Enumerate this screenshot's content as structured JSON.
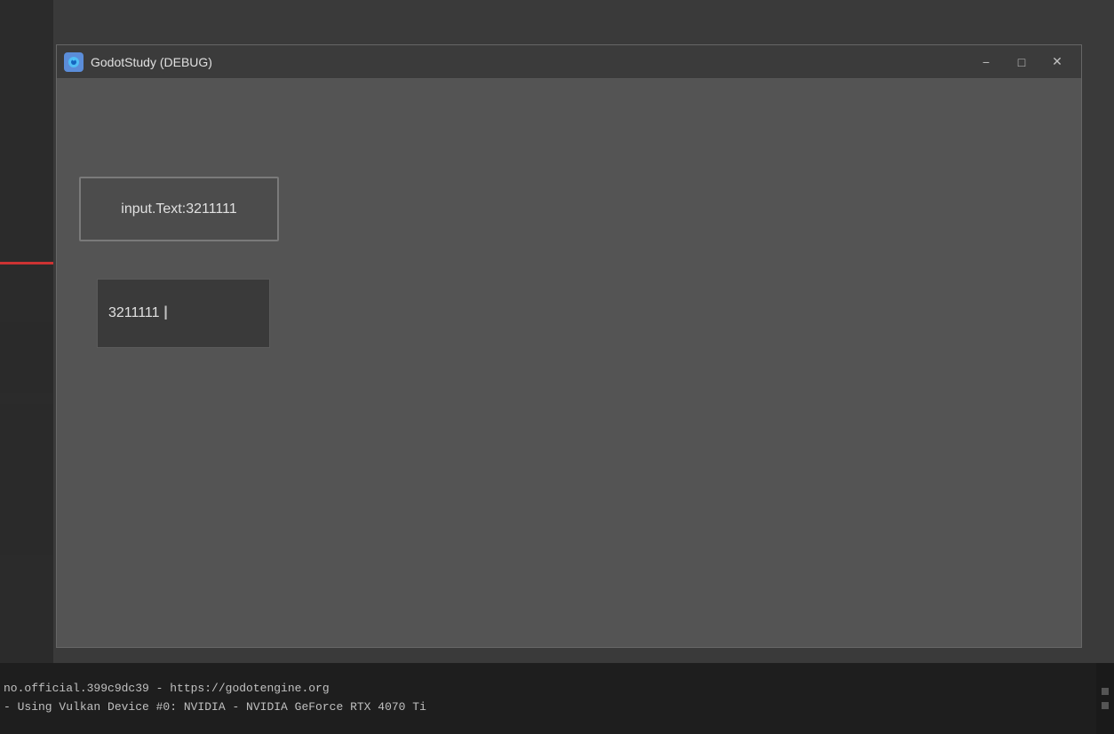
{
  "desktop": {
    "background_color": "#3a3a3a"
  },
  "window": {
    "title": "GodotStudy (DEBUG)",
    "icon_label": "godot-icon",
    "minimize_label": "−",
    "maximize_label": "□",
    "close_label": "✕"
  },
  "button": {
    "label": "input.Text:3211111"
  },
  "input": {
    "value": "3211111",
    "cursor": "I"
  },
  "statusbar": {
    "line1": "no.official.399c9dc39 - https://godotengine.org",
    "line2": " - Using Vulkan Device #0: NVIDIA - NVIDIA GeForce RTX 4070 Ti"
  }
}
